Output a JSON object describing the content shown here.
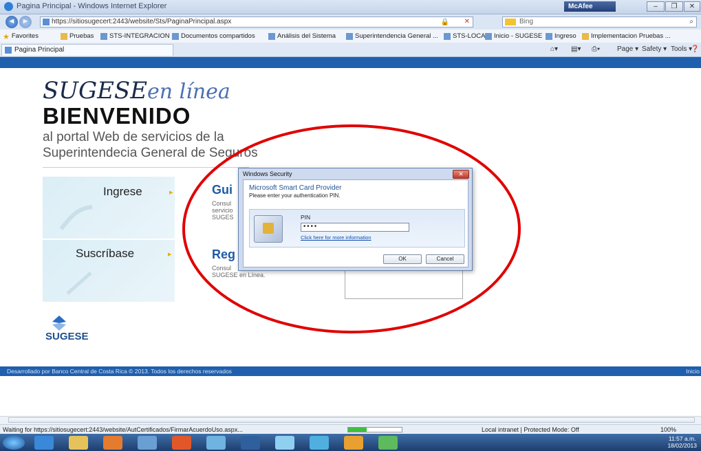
{
  "window": {
    "title": "Pagina Principal - Windows Internet Explorer",
    "mcafee": "McAfee",
    "buttons": {
      "minimize": "–",
      "restore": "❐",
      "close": "✕"
    }
  },
  "addressbar": {
    "back": "◄",
    "forward": "►",
    "url": "https://sitiosugecert:2443/website/Sts/PaginaPrincipal.aspx",
    "search_engine": "Bing",
    "search_placeholder": "Bing"
  },
  "favorites": {
    "label": "Favorites",
    "items": [
      "Pruebas",
      "STS-INTEGRACION",
      "Documentos compartidos",
      "Análisis del Sistema",
      "Superintendencia General ...",
      "STS-LOCAL",
      "Inicio - SUGESE",
      "Ingreso",
      "Implementacion Pruebas ..."
    ]
  },
  "tab": {
    "title": "Pagina Principal"
  },
  "commandbar": {
    "page": "Page ▾",
    "safety": "Safety ▾",
    "tools": "Tools ▾",
    "help": "❓▾"
  },
  "page": {
    "logo_script": "SUGESE",
    "logo_script_suffix": "en línea",
    "welcome": "BIENVENIDO",
    "subtitle_line1": "al portal Web de servicios de la",
    "subtitle_line2": "Superintendecia General de Seguros",
    "panels": [
      {
        "label": "Ingrese",
        "side_title": "Gui",
        "side_text": [
          "Consul",
          "servicio",
          "SUGES"
        ]
      },
      {
        "label": "Suscríbase",
        "side_title": "Reg",
        "side_text": [
          "Consul",
          "SUGESE en Línea."
        ]
      }
    ],
    "sugese_logo_text": "SUGESE",
    "footer": "Desarrollado por Banco Central de Costa Rica © 2013. Todos los derechos reservados",
    "footer_right": "Inicio"
  },
  "dialog": {
    "title": "Windows Security",
    "header": "Microsoft Smart Card Provider",
    "subheader": "Please enter your authentication PIN.",
    "pin_label": "PIN",
    "pin_value": "••••",
    "more_link": "Click here for more information",
    "ok": "OK",
    "cancel": "Cancel"
  },
  "statusbar": {
    "text": "Waiting for https://sitiosugecert:2443/website/AutCertificados/FirmarAcuerdoUso.aspx...",
    "zone": "Local intranet | Protected Mode: Off",
    "zoom": "100%",
    "progress": 0.35
  },
  "taskbar": {
    "clock_time": "11:57 a.m.",
    "clock_date": "18/02/2013"
  },
  "colors": {
    "accent_blue": "#1f5fae",
    "annotation_red": "#e00000"
  }
}
